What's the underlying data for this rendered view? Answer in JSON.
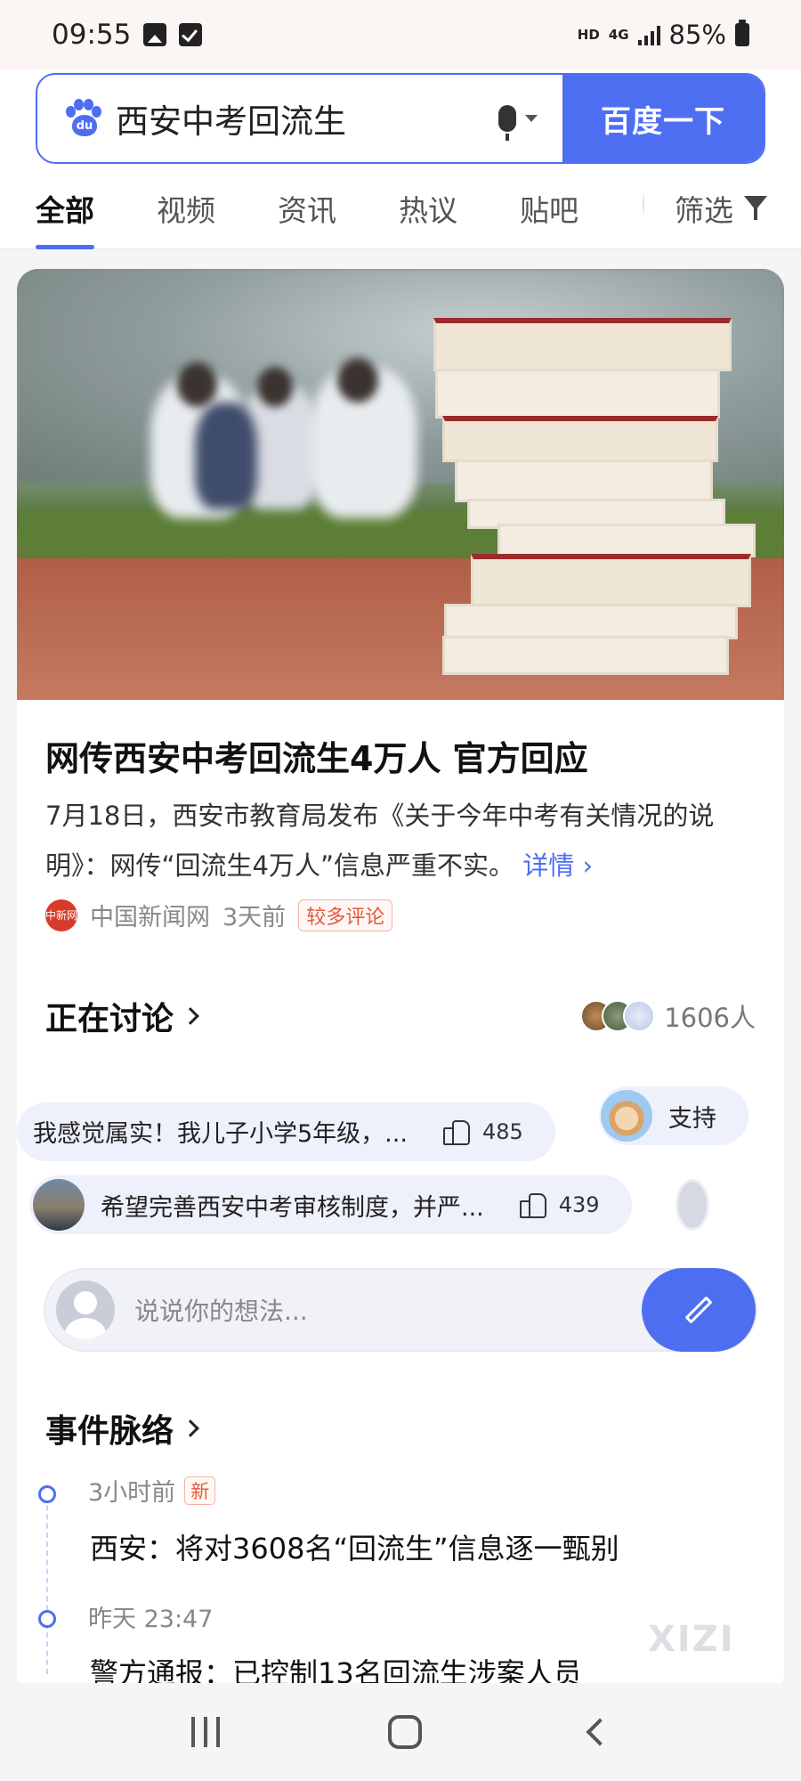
{
  "status_bar": {
    "time": "09:55",
    "hd": "HD",
    "net": "4G",
    "battery": "85%"
  },
  "search": {
    "query": "西安中考回流生",
    "button_label": "百度一下"
  },
  "tabs": [
    {
      "label": "全部",
      "active": true
    },
    {
      "label": "视频",
      "active": false
    },
    {
      "label": "资讯",
      "active": false
    },
    {
      "label": "热议",
      "active": false
    },
    {
      "label": "贴吧",
      "active": false
    }
  ],
  "filter_label": "筛选",
  "news_card": {
    "title": "网传西安中考回流生4万人 官方回应",
    "description": "7月18日，西安市教育局发布《关于今年中考有关情况的说明》：网传“回流生4万人”信息严重不实。",
    "more_label": "详情",
    "source_logo_text": "中新网",
    "source": "中国新闻网",
    "time": "3天前",
    "badge": "较多评论"
  },
  "discussion": {
    "title": "正在讨论",
    "participants": "1606人",
    "bubbles_row1": [
      {
        "text": "我感觉属实！我儿子小学5年级，...",
        "likes": "485"
      },
      {
        "text": "支持",
        "likes": ""
      }
    ],
    "bubbles_row2": [
      {
        "text": "希望完善西安中考审核制度，并严...",
        "likes": "439"
      }
    ],
    "comment_placeholder": "说说你的想法..."
  },
  "timeline": {
    "title": "事件脉络",
    "items": [
      {
        "time": "3小时前",
        "badge": "新",
        "title": "西安：将对3608名“回流生”信息逐一甄别"
      },
      {
        "time": "昨天 23:47",
        "badge": "",
        "title": "警方通报：已控制13名回流生涉案人员"
      }
    ]
  },
  "watermark": "XIZI",
  "colors": {
    "accent": "#4e6ef2",
    "hot_badge": "#e35a3a"
  }
}
